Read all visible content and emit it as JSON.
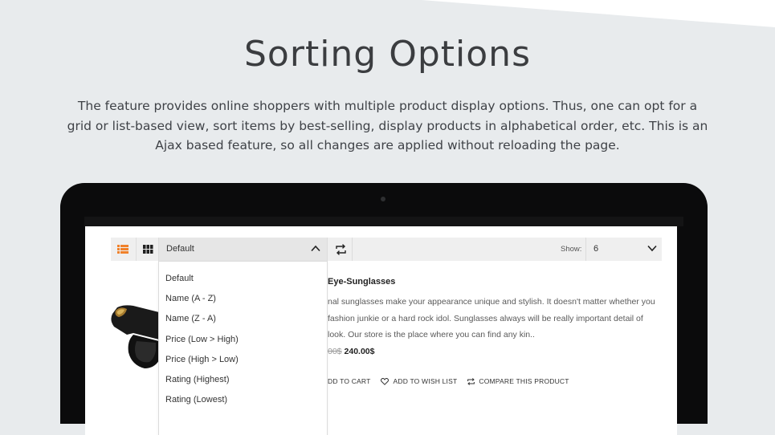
{
  "hero": {
    "title": "Sorting Options",
    "description": "The feature provides online shoppers with multiple product display options. Thus, one can opt for a grid or list-based view, sort items by best-selling, display products in alphabetical order, etc. This is an Ajax based feature, so all changes are applied without reloading the page."
  },
  "colors": {
    "accent": "#f0812a",
    "background": "#e8ebed",
    "laptop_bezel": "#0b0b0c"
  },
  "toolbar": {
    "list_view_icon": "list-view-icon",
    "grid_view_icon": "grid-view-icon",
    "sort_selected": "Default",
    "sort_open_icon": "chevron-up-icon",
    "direction_icon": "swap-icon",
    "show_label": "Show:",
    "show_value": "6",
    "show_icon": "chevron-down-icon"
  },
  "sort_options": [
    "Default",
    "Name (A - Z)",
    "Name (Z - A)",
    "Price (Low > High)",
    "Price (High > Low)",
    "Rating (Highest)",
    "Rating (Lowest)"
  ],
  "product": {
    "title_visible": "Eye-Sunglasses",
    "description_visible": "nal sunglasses make your appearance unique and stylish. It doesn't matter whether you fashion junkie or a hard rock idol. Sunglasses always will be really important detail of look. Our store is the place where you can find any kin..",
    "old_price_visible": "00$",
    "new_price": "240.00$",
    "add_to_cart_visible": "DD TO CART",
    "add_to_wishlist": "ADD TO WISH LIST",
    "compare": "COMPARE THIS PRODUCT"
  }
}
